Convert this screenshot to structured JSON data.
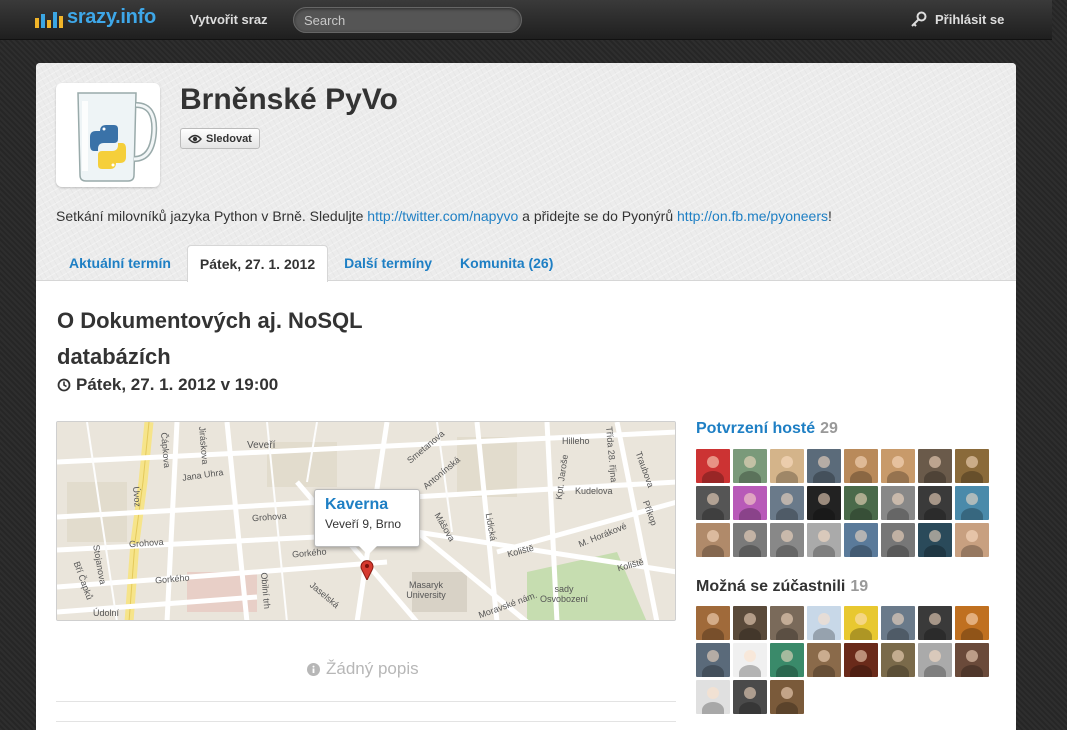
{
  "topbar": {
    "brand": "srazy.info",
    "create_label": "Vytvořit sraz",
    "search_placeholder": "Search",
    "login_label": "Přihlásit se"
  },
  "series": {
    "title": "Brněnské PyVo",
    "follow_label": "Sledovat",
    "description_before": "Setkání milovníků jazyka Python v Brně. Sleduljte ",
    "link1": "http://twitter.com/napyvo",
    "description_middle": " a přidejte se do Pyonýrů ",
    "link2": "http://on.fb.me/pyoneers",
    "description_after": "!"
  },
  "tabs": [
    {
      "label": "Aktuální termín",
      "active": false
    },
    {
      "label": "Pátek, 27. 1. 2012",
      "active": true
    },
    {
      "label": "Další termíny",
      "active": false
    },
    {
      "label": "Komunita (26)",
      "active": false
    }
  ],
  "event": {
    "title": "O Dokumentových aj. NoSQL databázích",
    "datetime": "Pátek, 27. 1. 2012 v 19:00",
    "no_description": "Žádný popis"
  },
  "map": {
    "venue_name": "Kaverna",
    "venue_address": "Veveří 9, Brno",
    "street_labels": [
      "Veveří",
      "Čápkova",
      "Jiráskova",
      "Jana Uhra",
      "Úvoz",
      "Grohova",
      "Stojanova",
      "Gorkého",
      "Gorkého",
      "Obilní trh",
      "Jaselská",
      "Údolní",
      "Smetanova",
      "Antonínská",
      "Mášova",
      "Lidická",
      "Kpt. Jaroše",
      "Hilleho",
      "Kudelova",
      "Třída 28. října",
      "Traubova",
      "M. Horákové",
      "Příkop",
      "Koliště",
      "Koliště",
      "Moravské nám.",
      "Masaryk University",
      "sady Osvobození",
      "Bří Čapků"
    ]
  },
  "confirmed": {
    "title": "Potvrzení hosté",
    "count": "29",
    "colors": [
      "#c33",
      "#7a9a7a",
      "#d4b48a",
      "#5b6b7a",
      "#b98a5a",
      "#c89a6a",
      "#6a5a4a",
      "#8a6a3a",
      "#555",
      "#b85ab8",
      "#6a7a8a",
      "#222",
      "#4a6a4a",
      "#888",
      "#3a3a3a",
      "#4a8aaa",
      "#b08a6a",
      "#7a7a7a",
      "#888",
      "#aaa",
      "#5a7a9a",
      "#777",
      "#2a4a5a",
      "#c8a080"
    ]
  },
  "maybe": {
    "title": "Možná se zúčastnili",
    "count": "19",
    "colors": [
      "#a06a3a",
      "#5a4a3a",
      "#7a6a5a",
      "#c8d8e8",
      "#e8c830",
      "#6a7a8a",
      "#3a3a3a",
      "#c07020",
      "#5a6a7a",
      "#f0f0f0",
      "#3a8a6a",
      "#8a6a4a",
      "#6a2a1a",
      "#7a6a4a",
      "#aaa",
      "#6a4a3a",
      "#e0e0e0",
      "#4a4a4a",
      "#7a5a3a"
    ]
  }
}
